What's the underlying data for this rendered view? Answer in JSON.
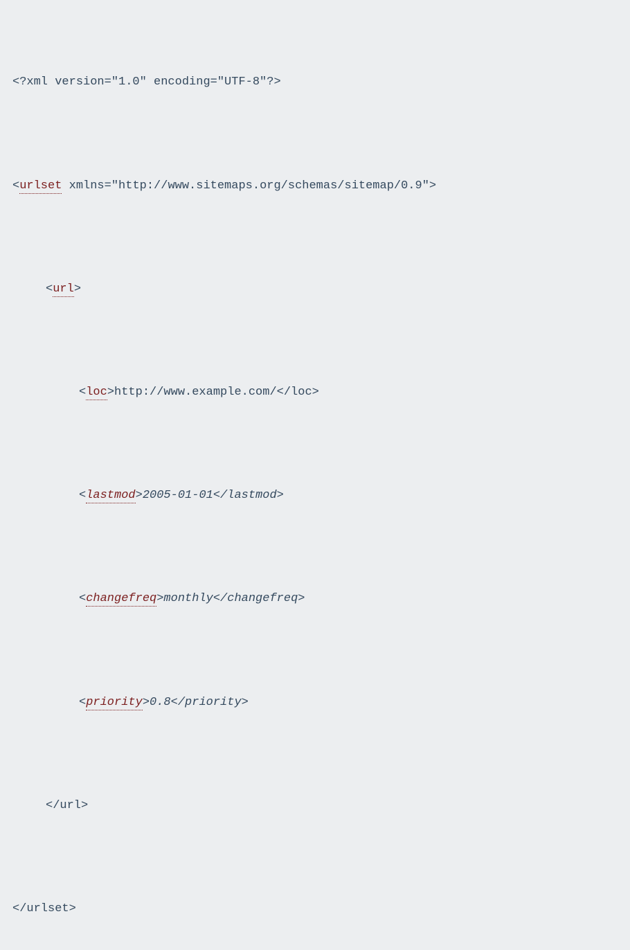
{
  "xml": {
    "prolog": "<?xml version=\"1.0\" encoding=\"UTF-8\"?>",
    "urlset_open_before": "<",
    "urlset_tag": "urlset",
    "urlset_open_after": " xmlns=\"http://www.sitemaps.org/schemas/sitemap/0.9\">",
    "url_open_before": "<",
    "url_tag": "url",
    "url_open_after": ">",
    "loc_before": "<",
    "loc_tag": "loc",
    "loc_mid": ">http://www.example.com/</loc>",
    "lastmod_before": "<",
    "lastmod_tag": "lastmod",
    "lastmod_mid": ">2005-01-01</lastmod>",
    "changefreq_before": "<",
    "changefreq_tag": "changefreq",
    "changefreq_mid": ">monthly</changefreq>",
    "priority_before": "<",
    "priority_tag": "priority",
    "priority_mid": ">0.8</priority>",
    "url_close": "</url>",
    "urlset_close": "</urlset>"
  }
}
